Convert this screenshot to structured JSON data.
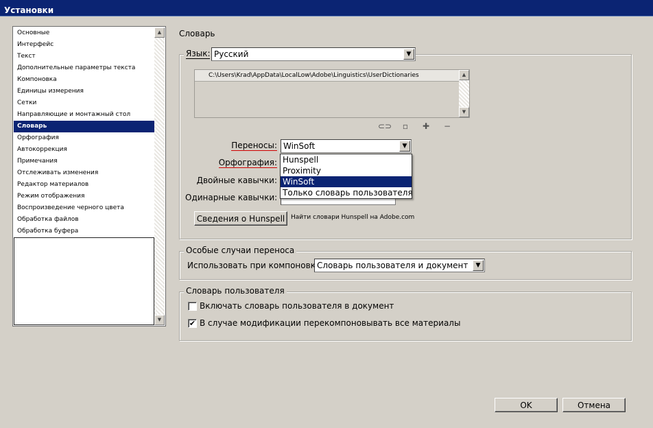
{
  "window": {
    "title": "Установки"
  },
  "sidebar": {
    "items": [
      {
        "label": "Основные"
      },
      {
        "label": "Интерфейс"
      },
      {
        "label": "Текст"
      },
      {
        "label": "Дополнительные параметры текста"
      },
      {
        "label": "Компоновка"
      },
      {
        "label": "Единицы измерения"
      },
      {
        "label": "Сетки"
      },
      {
        "label": "Направляющие и монтажный стол"
      },
      {
        "label": "Словарь",
        "selected": true
      },
      {
        "label": "Орфография"
      },
      {
        "label": "Автокоррекция"
      },
      {
        "label": "Примечания"
      },
      {
        "label": "Отслеживать изменения"
      },
      {
        "label": "Редактор материалов"
      },
      {
        "label": "Режим отображения"
      },
      {
        "label": "Воспроизведение черного цвета"
      },
      {
        "label": "Обработка файлов"
      },
      {
        "label": "Обработка буфера"
      }
    ]
  },
  "main": {
    "section_title": "Словарь",
    "language": {
      "label": "Язык:",
      "value": "Русский",
      "dictionary_path": "C:\\Users\\Krad\\AppData\\LocalLow\\Adobe\\Linguistics\\UserDictionaries"
    },
    "hyphenation": {
      "label": "Переносы:",
      "value": "WinSoft"
    },
    "hyphenation_options": [
      "Hunspell",
      "Proximity",
      "WinSoft",
      "Только словарь пользователя"
    ],
    "hyphenation_selected_index": 2,
    "spelling": {
      "label": "Орфография:"
    },
    "double_quotes": {
      "label": "Двойные кавычки:"
    },
    "single_quotes": {
      "label": "Одинарные кавычки:"
    },
    "hunspell_button": "Сведения о Hunspell",
    "hunspell_link": "Найти словари Hunspell на Adobe.com"
  },
  "exceptions": {
    "legend": "Особые случаи переноса",
    "compose_label": "Использовать при компоновке:",
    "compose_value": "Словарь пользователя и документ"
  },
  "user_dictionary": {
    "legend": "Словарь пользователя",
    "include_label": "Включать словарь пользователя в документ",
    "include_checked": false,
    "recompose_label": "В случае модификации перекомпоновывать все материалы",
    "recompose_checked": true,
    "check_mark": "✔"
  },
  "buttons": {
    "ok": "OK",
    "cancel": "Отмена"
  },
  "icons": {
    "scroll_up": "▲",
    "scroll_down": "▼",
    "dropdown_arrow": "▼",
    "link": "⊂⊃",
    "new": "▫",
    "add": "✚",
    "remove": "−"
  },
  "colors": {
    "selection": "#0b2473",
    "dialog_bg": "#d4d0c8",
    "annotation_underline": "#d00000"
  }
}
